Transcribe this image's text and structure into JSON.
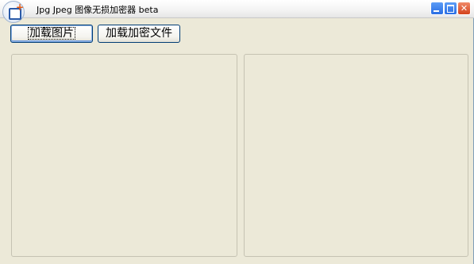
{
  "window": {
    "title": "Jpg Jpeg 图像无损加密器 beta",
    "icon": "app-add-document-icon"
  },
  "toolbar": {
    "load_image_label": "加载图片",
    "load_encrypted_label": "加载加密文件"
  },
  "controls": {
    "minimize": "minimize-icon",
    "maximize": "maximize-icon",
    "close": "close-icon"
  },
  "colors": {
    "window_bg": "#ece9d8",
    "button_border": "#003c74",
    "close_button": "#d3421c",
    "title_button": "#2a6de3"
  }
}
